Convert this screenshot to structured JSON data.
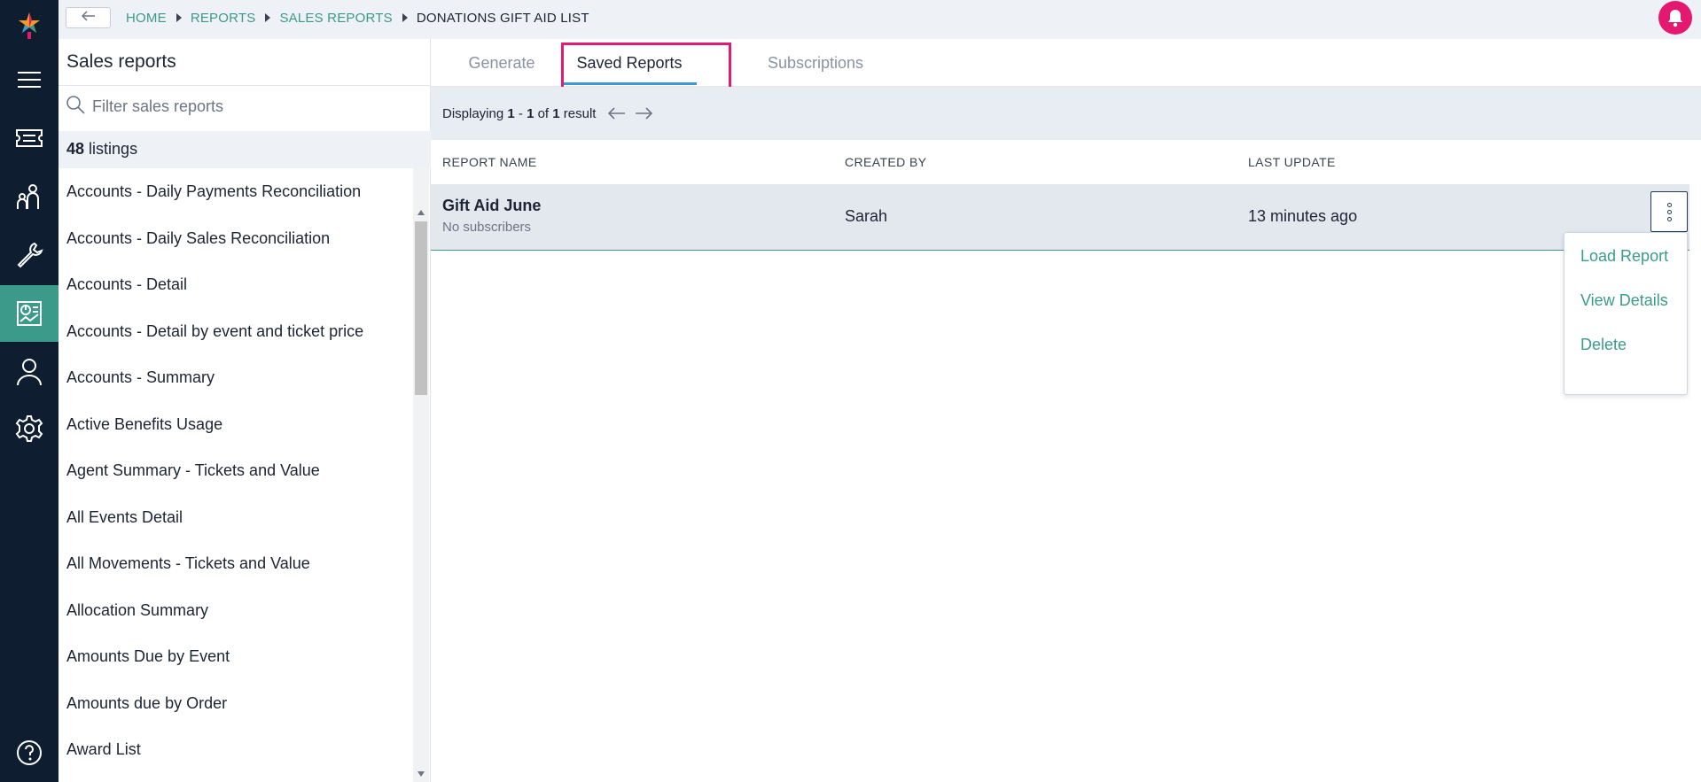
{
  "colors": {
    "accent": "#3b9a8a",
    "rail": "#0f1d31",
    "alert": "#e4186e",
    "highlight": "#e21b75"
  },
  "breadcrumb": {
    "back_icon": "arrow-left-icon",
    "items": [
      "HOME",
      "REPORTS",
      "SALES REPORTS"
    ],
    "current": "DONATIONS GIFT AID LIST"
  },
  "rail": {
    "icons": [
      "logo-icon",
      "menu-icon",
      "ticket-icon",
      "customers-icon",
      "tools-icon",
      "reports-icon",
      "user-icon",
      "settings-icon",
      "help-icon"
    ],
    "active": "reports-icon"
  },
  "sidebar": {
    "title": "Sales reports",
    "search_placeholder": "Filter sales reports",
    "count": "48",
    "count_label": "listings",
    "items": [
      "Accounts - Daily Payments Reconciliation",
      "Accounts - Daily Sales Reconciliation",
      "Accounts - Detail",
      "Accounts - Detail by event and ticket price",
      "Accounts - Summary",
      "Active Benefits Usage",
      "Agent Summary - Tickets and Value",
      "All Events Detail",
      "All Movements - Tickets and Value",
      "Allocation Summary",
      "Amounts Due by Event",
      "Amounts due by Order",
      "Award List"
    ]
  },
  "tabs": [
    {
      "label": "Generate",
      "active": false
    },
    {
      "label": "Saved Reports",
      "active": true
    },
    {
      "label": "Subscriptions",
      "active": false
    }
  ],
  "pager": {
    "prefix": "Displaying",
    "from": "1",
    "dash": "-",
    "to": "1",
    "of": "of",
    "total": "1",
    "suffix": "result"
  },
  "table": {
    "headers": [
      "REPORT NAME",
      "CREATED BY",
      "LAST UPDATE"
    ],
    "rows": [
      {
        "name": "Gift Aid June",
        "subscribers": "No subscribers",
        "created_by": "Sarah",
        "last_update": "13 minutes ago"
      }
    ]
  },
  "row_menu": {
    "items": [
      "Load Report",
      "View Details",
      "Delete"
    ]
  }
}
